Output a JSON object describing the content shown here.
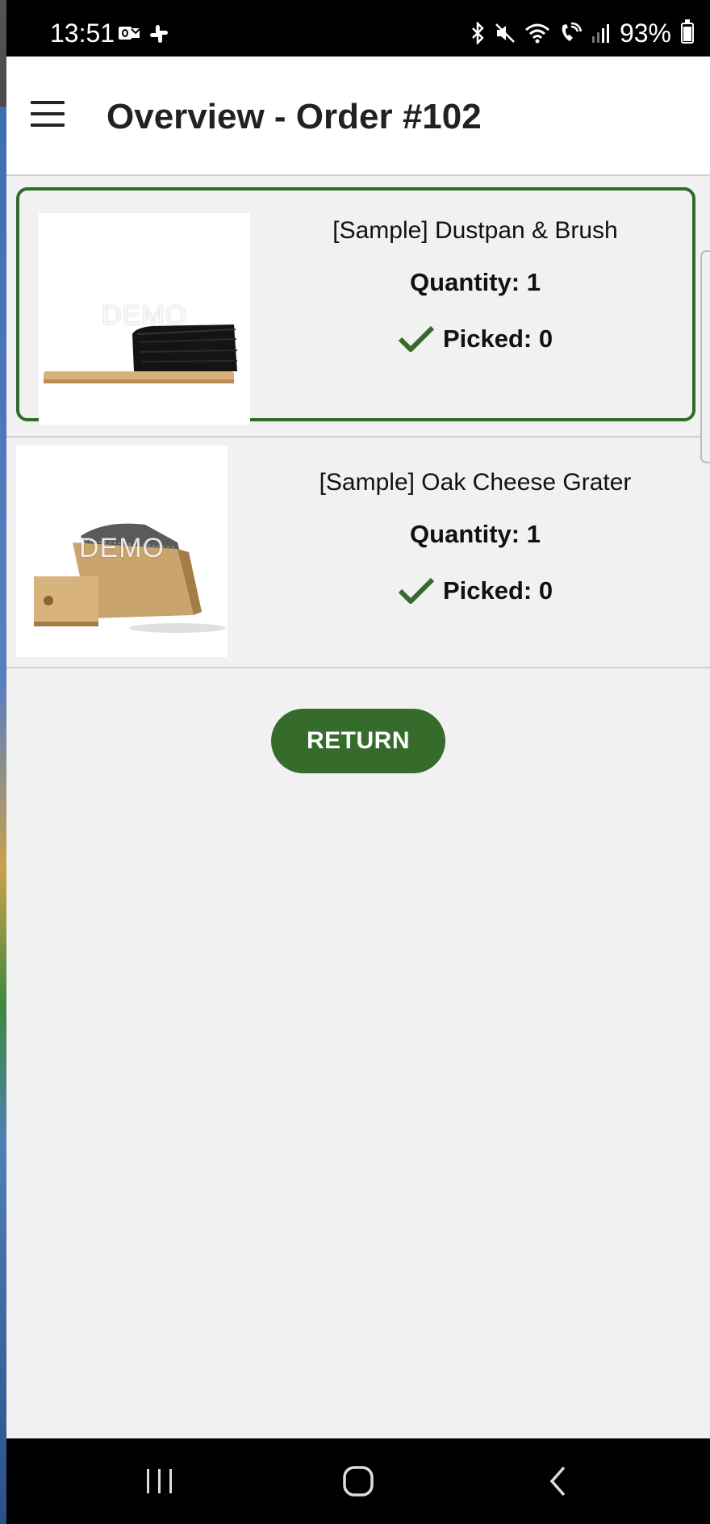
{
  "status_bar": {
    "time": "13:51",
    "battery": "93%",
    "left_icons": [
      "outlook-icon",
      "slack-icon"
    ],
    "right_icons": [
      "bluetooth-icon",
      "mute-icon",
      "wifi-icon",
      "wifi-call-icon",
      "signal-icon",
      "battery-icon"
    ]
  },
  "app_bar": {
    "title": "Overview - Order #102",
    "menu_icon": "hamburger-menu-icon"
  },
  "items": [
    {
      "name": "[Sample] Dustpan & Brush",
      "quantity": "Quantity: 1",
      "picked": "Picked: 0",
      "watermark": "DEMO",
      "selected": true
    },
    {
      "name": "[Sample] Oak Cheese Grater",
      "quantity": "Quantity: 1",
      "picked": "Picked: 0",
      "watermark": "DEMO",
      "selected": false
    }
  ],
  "return_button": "RETURN",
  "colors": {
    "accent": "#356b2b",
    "background": "#f1f1f1"
  },
  "nav_bar": {
    "buttons": [
      "recent-apps-icon",
      "home-icon",
      "back-icon"
    ]
  }
}
